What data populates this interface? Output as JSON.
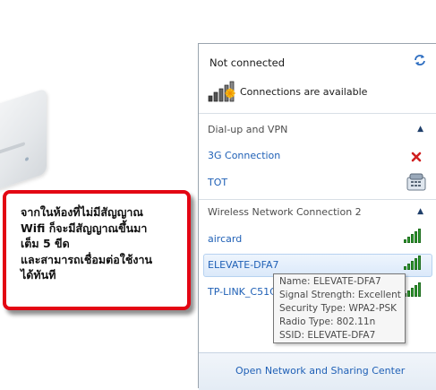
{
  "callout": {
    "lines": [
      "จากในห้องที่ไม่มีสัญญาณ",
      "Wifi ก็จะมีสัญญาณขึ้นมา",
      "เต็ม 5 ขีด",
      "และสามารถเชื่อมต่อใช้งาน",
      "ได้ทันที"
    ]
  },
  "panel": {
    "status": "Not connected",
    "connections_available": "Connections are available",
    "dialup_header": "Dial-up and VPN",
    "dialup_items": [
      "3G Connection",
      "TOT"
    ],
    "wireless_header": "Wireless Network Connection 2",
    "wireless_items": [
      {
        "name": "aircard",
        "signal": 5
      },
      {
        "name": "ELEVATE-DFA7",
        "signal": 5
      },
      {
        "name": "TP-LINK_C51C",
        "signal": 5
      }
    ],
    "footer_link": "Open Network and Sharing Center"
  },
  "tooltip": {
    "lines": [
      "Name: ELEVATE-DFA7",
      "Signal Strength: Excellent",
      "Security Type: WPA2-PSK",
      "Radio Type: 802.11n",
      "SSID: ELEVATE-DFA7"
    ]
  },
  "colors": {
    "link": "#1f60b6",
    "callout_border": "#e30613",
    "signal": "#2f9e2f",
    "disconnect": "#d02020"
  }
}
